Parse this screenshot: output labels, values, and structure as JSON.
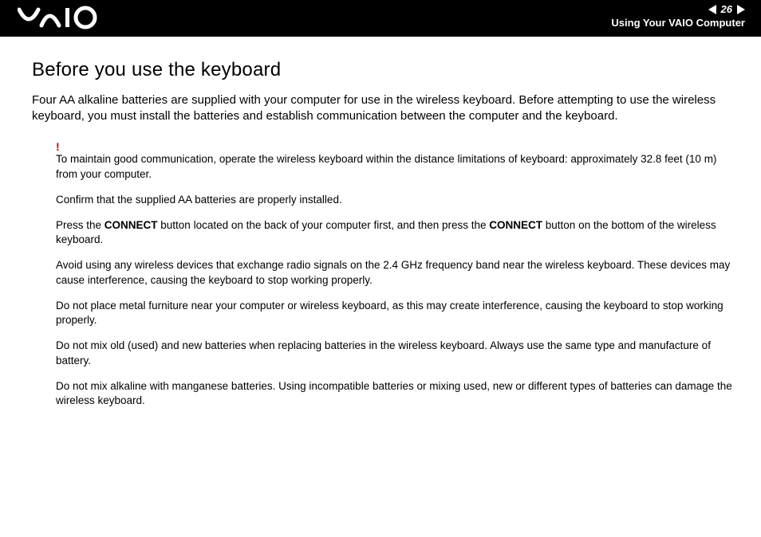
{
  "header": {
    "page_number": "26",
    "section_title": "Using Your VAIO Computer"
  },
  "title": "Before you use the keyboard",
  "intro": "Four AA alkaline batteries are supplied with your computer for use in the wireless keyboard. Before attempting to use the wireless keyboard, you must install the batteries and establish communication between the computer and the keyboard.",
  "warning_mark": "!",
  "notes": {
    "n0": "To maintain good communication, operate the wireless keyboard within the distance limitations of keyboard: approximately 32.8 feet (10 m) from your computer.",
    "n1": "Confirm that the supplied AA batteries are properly installed.",
    "n2a": "Press the ",
    "n2b": "CONNECT",
    "n2c": " button located on the back of your computer first, and then press the ",
    "n2d": "CONNECT",
    "n2e": " button on the bottom of the wireless keyboard.",
    "n3": "Avoid using any wireless devices that exchange radio signals on the 2.4 GHz frequency band near the wireless keyboard. These devices may cause interference, causing the keyboard to stop working properly.",
    "n4": "Do not place metal furniture near your computer or wireless keyboard, as this may create interference, causing the keyboard to stop working properly.",
    "n5": "Do not mix old (used) and new batteries when replacing batteries in the wireless keyboard. Always use the same type and manufacture of battery.",
    "n6": "Do not mix alkaline with manganese batteries. Using incompatible batteries or mixing used, new or different types of batteries can damage the wireless keyboard."
  }
}
